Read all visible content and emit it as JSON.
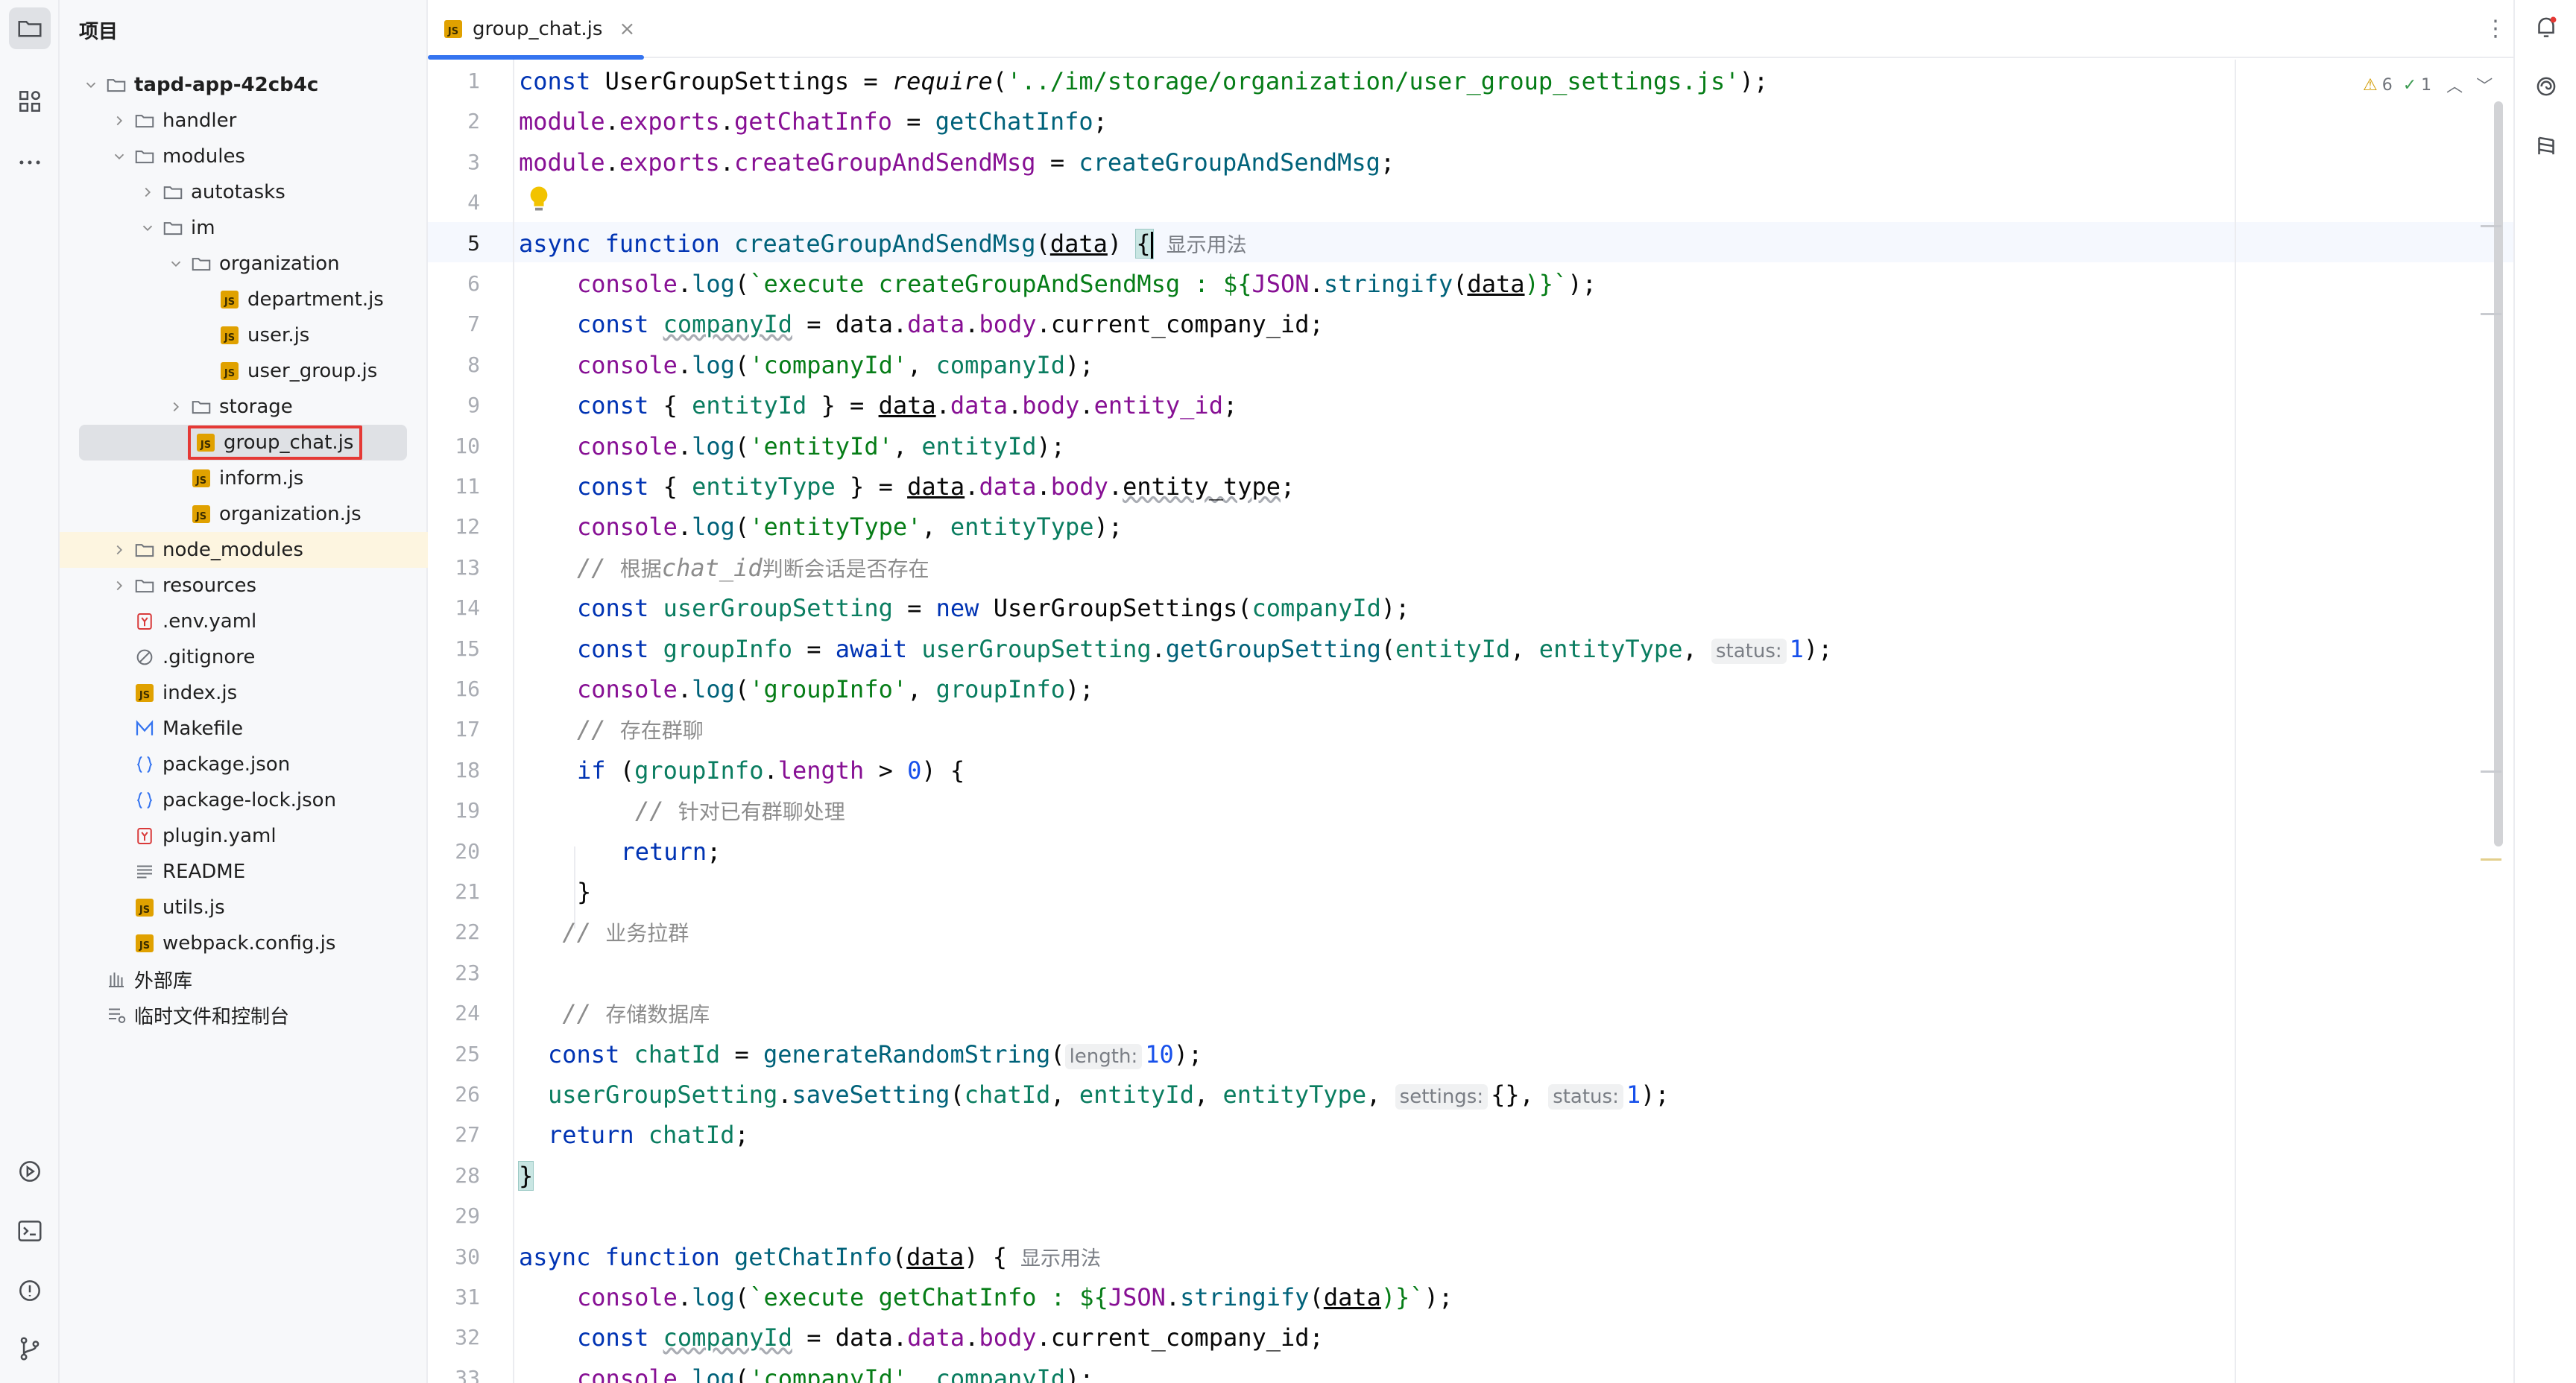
{
  "project_panel": {
    "title": "项目",
    "tree": [
      {
        "label": "tapd-app-42cb4c",
        "kind": "folder",
        "depth": 0,
        "expanded": true,
        "bold": true
      },
      {
        "label": "handler",
        "kind": "folder",
        "depth": 1,
        "expanded": false
      },
      {
        "label": "modules",
        "kind": "folder",
        "depth": 1,
        "expanded": true
      },
      {
        "label": "autotasks",
        "kind": "folder",
        "depth": 2,
        "expanded": false
      },
      {
        "label": "im",
        "kind": "folder",
        "depth": 2,
        "expanded": true
      },
      {
        "label": "organization",
        "kind": "folder",
        "depth": 3,
        "expanded": true
      },
      {
        "label": "department.js",
        "kind": "js",
        "depth": 4
      },
      {
        "label": "user.js",
        "kind": "js",
        "depth": 4
      },
      {
        "label": "user_group.js",
        "kind": "js",
        "depth": 4
      },
      {
        "label": "storage",
        "kind": "folder",
        "depth": 3,
        "expanded": false
      },
      {
        "label": "group_chat.js",
        "kind": "js",
        "depth": 3,
        "selected": true
      },
      {
        "label": "inform.js",
        "kind": "js",
        "depth": 3
      },
      {
        "label": "organization.js",
        "kind": "js",
        "depth": 3
      },
      {
        "label": "node_modules",
        "kind": "folder",
        "depth": 1,
        "expanded": false,
        "highlight": true
      },
      {
        "label": "resources",
        "kind": "folder",
        "depth": 1,
        "expanded": false
      },
      {
        "label": ".env.yaml",
        "kind": "yaml",
        "depth": 1
      },
      {
        "label": ".gitignore",
        "kind": "ignore",
        "depth": 1
      },
      {
        "label": "index.js",
        "kind": "js",
        "depth": 1
      },
      {
        "label": "Makefile",
        "kind": "make",
        "depth": 1
      },
      {
        "label": "package.json",
        "kind": "json",
        "depth": 1
      },
      {
        "label": "package-lock.json",
        "kind": "json",
        "depth": 1
      },
      {
        "label": "plugin.yaml",
        "kind": "yaml",
        "depth": 1
      },
      {
        "label": "README",
        "kind": "text",
        "depth": 1
      },
      {
        "label": "utils.js",
        "kind": "js",
        "depth": 1
      },
      {
        "label": "webpack.config.js",
        "kind": "js",
        "depth": 1
      },
      {
        "label": "外部库",
        "kind": "lib",
        "depth": 0
      },
      {
        "label": "临时文件和控制台",
        "kind": "scratch",
        "depth": 0
      }
    ]
  },
  "editor": {
    "tab_label": "group_chat.js",
    "tab_close": "×",
    "more_menu": "⋮",
    "inspection": {
      "warnings": "6",
      "ok": "1"
    },
    "line_numbers": [
      "1",
      "2",
      "3",
      "4",
      "5",
      "6",
      "7",
      "8",
      "9",
      "10",
      "11",
      "12",
      "13",
      "14",
      "15",
      "16",
      "17",
      "18",
      "19",
      "20",
      "21",
      "22",
      "23",
      "24",
      "25",
      "26",
      "27",
      "28",
      "29",
      "30",
      "31",
      "32",
      "33"
    ],
    "lines": {
      "l1": {
        "a": "const",
        "b": " UserGroupSettings = ",
        "c": "require",
        "d": "(",
        "e": "'../im/storage/organization/user_group_settings.js'",
        "f": ");"
      },
      "l2": {
        "a": "module",
        "b": ".",
        "c": "exports",
        "d": ".",
        "e": "getChatInfo",
        "f": " = ",
        "g": "getChatInfo",
        "h": ";"
      },
      "l3": {
        "a": "module",
        "b": ".",
        "c": "exports",
        "d": ".",
        "e": "createGroupAndSendMsg",
        "f": " = ",
        "g": "createGroupAndSendMsg",
        "h": ";"
      },
      "l5": {
        "a": "async function",
        "b": " ",
        "c": "createGroupAndSendMsg",
        "d": "(",
        "e": "data",
        "f": ") ",
        "g": "{",
        "h": "显示用法"
      },
      "l6": {
        "a": "console",
        "b": ".",
        "c": "log",
        "d": "(",
        "e": "`execute createGroupAndSendMsg : ${",
        "f": "JSON",
        "g": ".",
        "h": "stringify",
        "i": "(",
        "j": "data",
        "k": ")}`",
        "l": ");"
      },
      "l7": {
        "a": "const",
        "b": " ",
        "c": "companyId",
        "d": " = data.",
        "e": "data",
        "f": ".",
        "g": "body",
        "h": ".current_company_id;"
      },
      "l8": {
        "a": "console",
        "b": ".",
        "c": "log",
        "d": "(",
        "e": "'companyId'",
        "f": ", ",
        "g": "companyId",
        "h": ");"
      },
      "l9": {
        "a": "const",
        "b": " { ",
        "c": "entityId",
        "d": " } = ",
        "e": "data",
        "f": ".",
        "g": "data",
        "h": ".",
        "i": "body",
        "j": ".",
        "k": "entity_id",
        "l": ";"
      },
      "l10": {
        "a": "console",
        "b": ".",
        "c": "log",
        "d": "(",
        "e": "'entityId'",
        "f": ", ",
        "g": "entityId",
        "h": ");"
      },
      "l11": {
        "a": "const",
        "b": " { ",
        "c": "entityType",
        "d": " } = ",
        "e": "data",
        "f": ".",
        "g": "data",
        "h": ".",
        "i": "body",
        "j": ".",
        "k": "entity_type",
        "l": ";"
      },
      "l12": {
        "a": "console",
        "b": ".",
        "c": "log",
        "d": "(",
        "e": "'entityType'",
        "f": ", ",
        "g": "entityType",
        "h": ");"
      },
      "l13": {
        "a": "// ",
        "b": "根据",
        "c": "chat_id",
        "d": "判断会话是否存在"
      },
      "l14": {
        "a": "const",
        "b": " ",
        "c": "userGroupSetting",
        "d": " = ",
        "e": "new",
        "f": " UserGroupSettings(",
        "g": "companyId",
        "h": ");"
      },
      "l15": {
        "a": "const",
        "b": " ",
        "c": "groupInfo",
        "d": " = ",
        "e": "await",
        "f": " ",
        "g": "userGroupSetting",
        "h": ".",
        "i": "getGroupSetting",
        "j": "(",
        "k": "entityId",
        "l": ", ",
        "m": "entityType",
        "n": ", ",
        "o": "status:",
        "p": "1",
        "q": ");"
      },
      "l16": {
        "a": "console",
        "b": ".",
        "c": "log",
        "d": "(",
        "e": "'groupInfo'",
        "f": ", ",
        "g": "groupInfo",
        "h": ");"
      },
      "l17": {
        "a": "// ",
        "b": "存在群聊"
      },
      "l18": {
        "a": "if",
        "b": " (",
        "c": "groupInfo",
        "d": ".",
        "e": "length",
        "f": " > ",
        "g": "0",
        "h": ") {"
      },
      "l19": {
        "a": "// ",
        "b": "针对已有群聊处理"
      },
      "l20": {
        "a": "return",
        "b": ";"
      },
      "l21": {
        "a": "}"
      },
      "l22": {
        "a": "// ",
        "b": "业务拉群"
      },
      "l24": {
        "a": "// ",
        "b": "存储数据库"
      },
      "l25": {
        "a": "const",
        "b": " ",
        "c": "chatId",
        "d": " = ",
        "e": "generateRandomString",
        "f": "(",
        "g": "length:",
        "h": "10",
        "i": ");"
      },
      "l26": {
        "a": "userGroupSetting",
        "b": ".",
        "c": "saveSetting",
        "d": "(",
        "e": "chatId",
        "f": ", ",
        "g": "entityId",
        "h": ", ",
        "i": "entityType",
        "j": ", ",
        "k": "settings:",
        "l": "{}",
        "m": ", ",
        "n": "status:",
        "o": "1",
        "p": ");"
      },
      "l27": {
        "a": "return",
        "b": " ",
        "c": "chatId",
        "d": ";"
      },
      "l28": {
        "a": "}"
      },
      "l30": {
        "a": "async function",
        "b": " ",
        "c": "getChatInfo",
        "d": "(",
        "e": "data",
        "f": ") {",
        "g": "显示用法"
      },
      "l31": {
        "a": "console",
        "b": ".",
        "c": "log",
        "d": "(",
        "e": "`execute getChatInfo : ${",
        "f": "JSON",
        "g": ".",
        "h": "stringify",
        "i": "(",
        "j": "data",
        "k": ")}`",
        "l": ");"
      },
      "l32": {
        "a": "const",
        "b": " ",
        "c": "companyId",
        "d": " = data.",
        "e": "data",
        "f": ".",
        "g": "body",
        "h": ".current_company_id;"
      },
      "l33": {
        "a": "console",
        "b": ".",
        "c": "log",
        "d": "(",
        "e": "'companyId'",
        "f": ", ",
        "g": "companyId",
        "h": ");"
      }
    }
  },
  "icons": {
    "left": [
      "folder-icon",
      "structure-icon",
      "more-icon",
      "run-icon",
      "terminal-icon",
      "problems-icon",
      "git-icon"
    ],
    "right": [
      "notifications-icon",
      "ai-assistant-icon",
      "database-icon"
    ]
  },
  "colors": {
    "accent": "#3574f0",
    "keyword": "#0033b3",
    "string": "#067d17",
    "selection_box": "#e53935",
    "js_badge": "#e0a100"
  }
}
